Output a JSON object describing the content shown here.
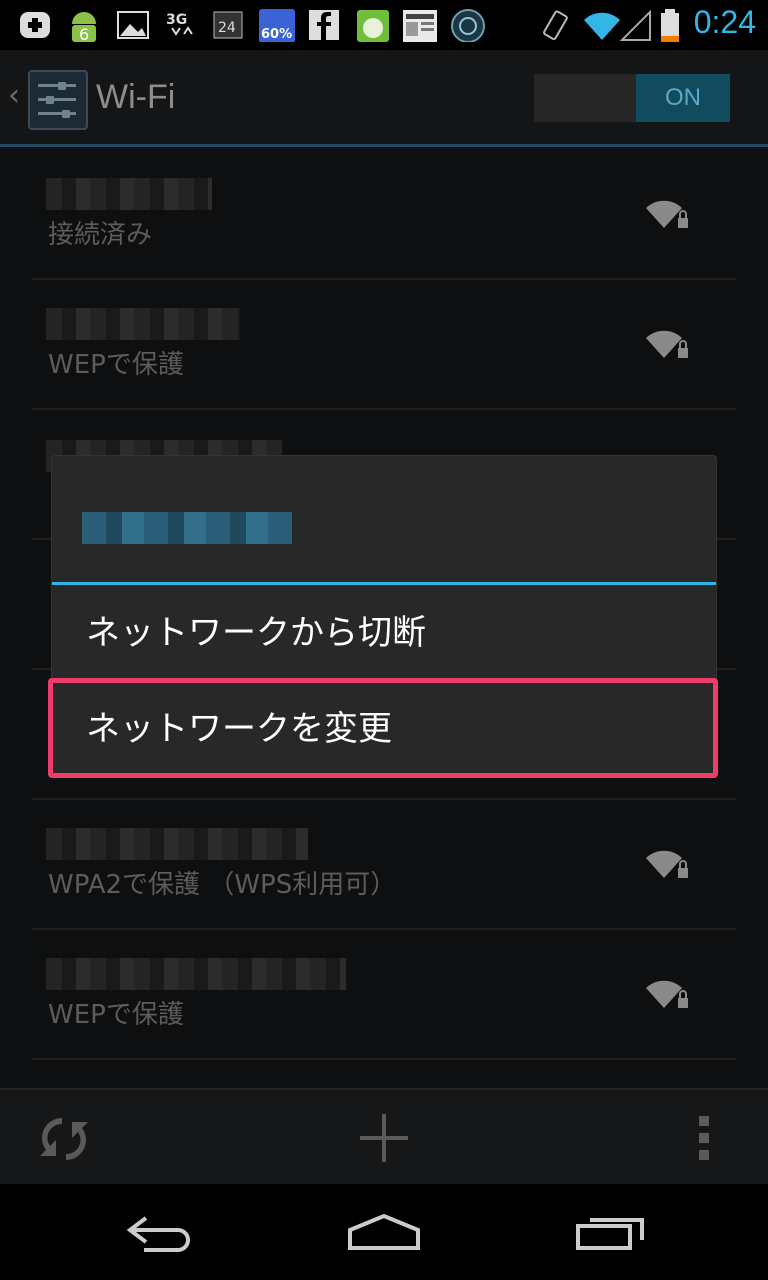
{
  "status_bar": {
    "time": "0:24",
    "notification_icons": [
      "add-icon",
      "android-badge-icon",
      "image-icon",
      "3g-data-icon",
      "calendar-icon",
      "weather-icon",
      "facebook-icon",
      "app-icon",
      "news-icon",
      "camera-icon"
    ],
    "badge_number": "6",
    "weather_percent": "60%",
    "calendar_number": "24",
    "network_label": "3G",
    "system_icons": [
      "vibrate-icon",
      "wifi-signal-icon",
      "cell-signal-icon",
      "battery-icon"
    ],
    "clock_color": "#33b5e5"
  },
  "action_bar": {
    "title": "Wi-Fi",
    "toggle_label": "ON"
  },
  "networks": [
    {
      "status": "接続済み"
    },
    {
      "status": "WEPで保護"
    },
    {
      "status": ""
    },
    {
      "status": ""
    },
    {
      "status": ""
    },
    {
      "status": "WPA2で保護 （WPS利用可）"
    },
    {
      "status": "WEPで保護"
    }
  ],
  "dialog": {
    "items": [
      {
        "label": "ネットワークから切断"
      },
      {
        "label": "ネットワークを変更"
      }
    ],
    "accent": "#33b5e5",
    "highlight_color": "#ee3d6b"
  },
  "bottom_bar": {
    "icons": [
      "sync-icon",
      "add-network-icon",
      "overflow-menu-icon"
    ]
  },
  "nav_bar": {
    "icons": [
      "back-icon",
      "home-icon",
      "recent-apps-icon"
    ]
  }
}
